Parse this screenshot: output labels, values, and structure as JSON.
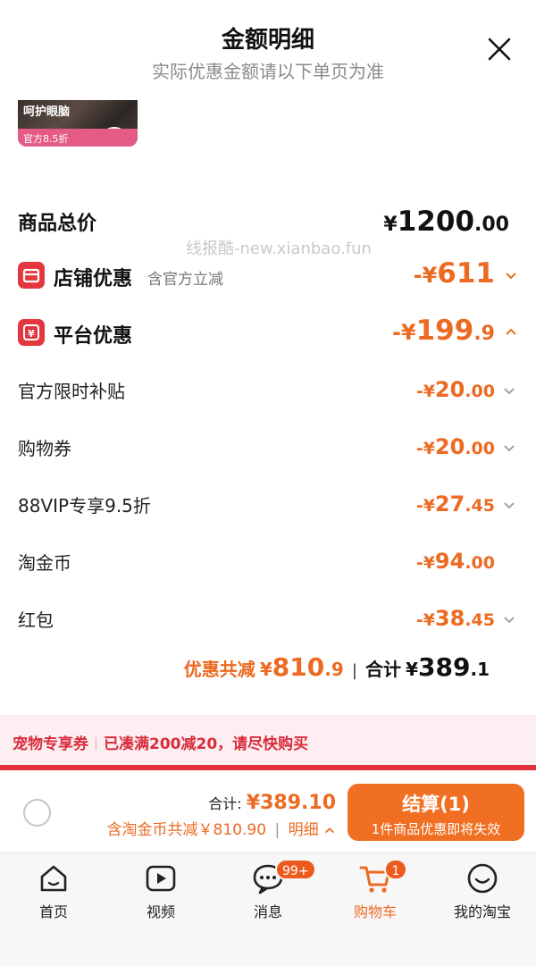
{
  "header": {
    "title": "金额明细",
    "subtitle": "实际优惠金额请以下单页为准"
  },
  "product_thumb": {
    "caption": "呵护眼脑",
    "badge": "官方8.5折"
  },
  "watermark": "线报酷-new.xianbao.fun",
  "total": {
    "label": "商品总价",
    "currency": "¥",
    "int": "1200",
    "dec": ".00"
  },
  "shop_discount": {
    "label": "店铺优惠",
    "note": "含官方立减",
    "prefix": "-¥",
    "int": "611",
    "dec": ""
  },
  "platform_discount": {
    "label": "平台优惠",
    "prefix": "-¥",
    "int": "199",
    "dec": ".9"
  },
  "items": [
    {
      "label": "官方限时补贴",
      "prefix": "-¥",
      "int": "20",
      "dec": ".00",
      "chevron": true
    },
    {
      "label": "购物券",
      "prefix": "-¥",
      "int": "20",
      "dec": ".00",
      "chevron": true
    },
    {
      "label": "88VIP专享9.5折",
      "prefix": "-¥",
      "int": "27",
      "dec": ".45",
      "chevron": true
    },
    {
      "label": "淘金币",
      "prefix": "-¥",
      "int": "94",
      "dec": ".00",
      "chevron": false
    },
    {
      "label": "红包",
      "prefix": "-¥",
      "int": "38",
      "dec": ".45",
      "chevron": true
    }
  ],
  "summary": {
    "discount_label": "优惠共减",
    "discount_prefix": "¥",
    "discount_int": "810",
    "discount_dec": ".9",
    "sep": "|",
    "total_label": "合计",
    "total_prefix": "¥",
    "total_int": "389",
    "total_dec": ".1"
  },
  "promo": {
    "tag": "宠物专享券",
    "text": "已凑满200减20，请尽快购买"
  },
  "bottom_bar": {
    "sum_label": "合计:",
    "sum_amount": "¥389.10",
    "sum_note": "含淘金币共减￥810.90",
    "detail_label": "明细",
    "checkout_label": "结算(1)",
    "checkout_note": "1件商品优惠即将失效"
  },
  "tabs": [
    {
      "label": "首页",
      "icon": "home-icon"
    },
    {
      "label": "视频",
      "icon": "video-icon"
    },
    {
      "label": "消息",
      "icon": "message-icon",
      "badge": "99+"
    },
    {
      "label": "购物车",
      "icon": "cart-icon",
      "badge": "1",
      "active": true
    },
    {
      "label": "我的淘宝",
      "icon": "profile-icon"
    }
  ],
  "colors": {
    "accent": "#ec6a22",
    "red": "#e4363f",
    "checkout": "#f06f22",
    "promo_bg": "#fdeef1"
  }
}
